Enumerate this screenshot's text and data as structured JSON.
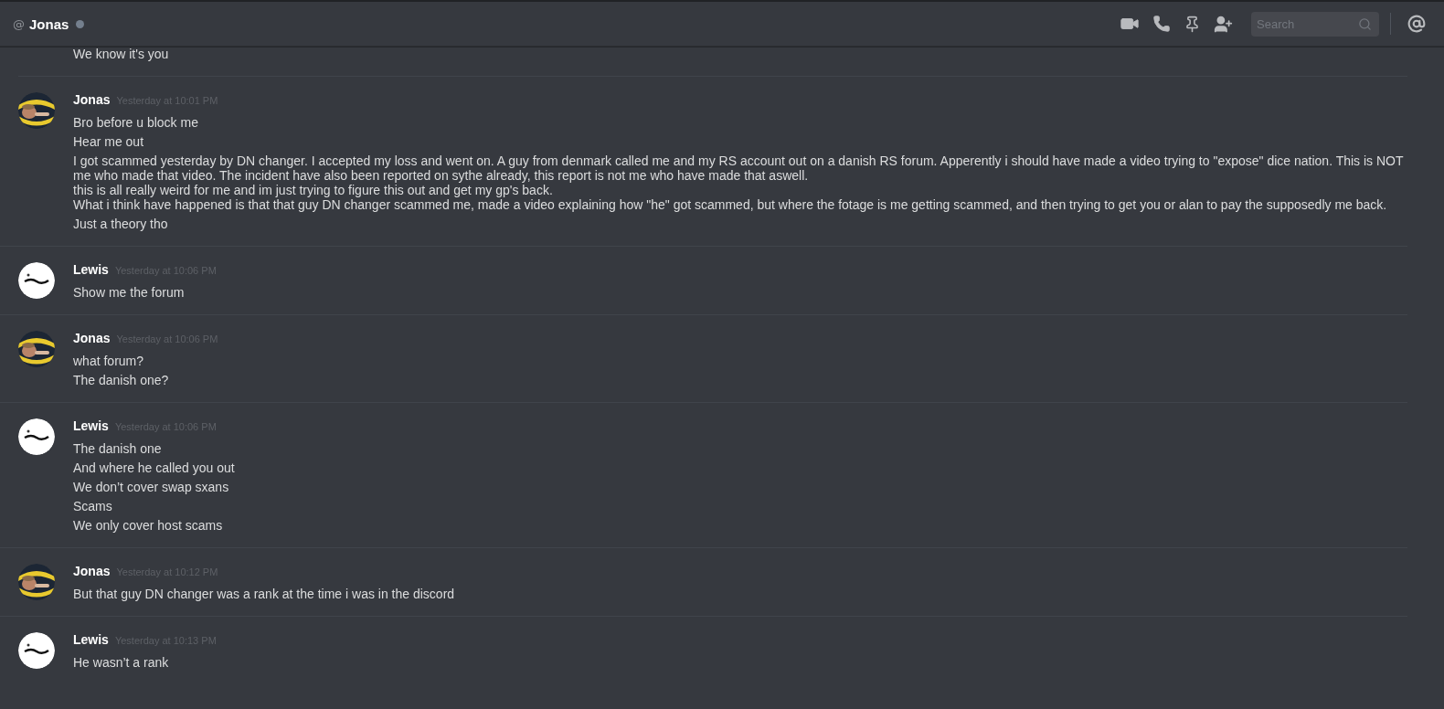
{
  "header": {
    "prefix": "@",
    "title": "Jonas",
    "online": false,
    "search": {
      "placeholder": "Search"
    }
  },
  "previous_message": "We know it's you",
  "groups": [
    {
      "author": "Jonas",
      "avatar": {
        "kind": "picture"
      },
      "timestamp": "Yesterday at 10:01 PM",
      "messages": [
        "Bro before u block me",
        "Hear me out",
        "I got scammed yesterday by DN changer. I accepted my loss and went on. A guy from denmark called me and my RS account out on a danish RS forum. Apperently i should have made a video trying to \"expose\" dice nation. This is NOT me who made that video. The incident have also been reported on sythe already, this report is not me who have made that aswell.\nthis is all really weird for me and im just trying to figure this out and get my gp's back.\nWhat i think have happened is that that guy DN changer scammed me, made a video explaining how \"he\" got scammed, but where the fotage is me getting scammed, and then trying to get you or alan to pay the supposedly me back.",
        "Just a theory tho"
      ]
    },
    {
      "author": "Lewis",
      "avatar": {
        "kind": "picture"
      },
      "timestamp": "Yesterday at 10:06 PM",
      "messages": [
        "Show me the forum"
      ]
    },
    {
      "author": "Jonas",
      "avatar": {
        "kind": "picture"
      },
      "timestamp": "Yesterday at 10:06 PM",
      "messages": [
        "what forum?",
        "The danish one?"
      ]
    },
    {
      "author": "Lewis",
      "avatar": {
        "kind": "picture"
      },
      "timestamp": "Yesterday at 10:06 PM",
      "messages": [
        "The danish one",
        "And where he called you out",
        "We don’t cover swap sxans",
        "Scams",
        "We only cover host scams"
      ]
    },
    {
      "author": "Jonas",
      "avatar": {
        "kind": "picture"
      },
      "timestamp": "Yesterday at 10:12 PM",
      "messages": [
        "But that guy DN changer was a rank at the time i was in the discord"
      ]
    },
    {
      "author": "Lewis",
      "avatar": {
        "kind": "picture"
      },
      "timestamp": "Yesterday at 10:13 PM",
      "messages": [
        "He wasn’t a rank"
      ]
    }
  ]
}
